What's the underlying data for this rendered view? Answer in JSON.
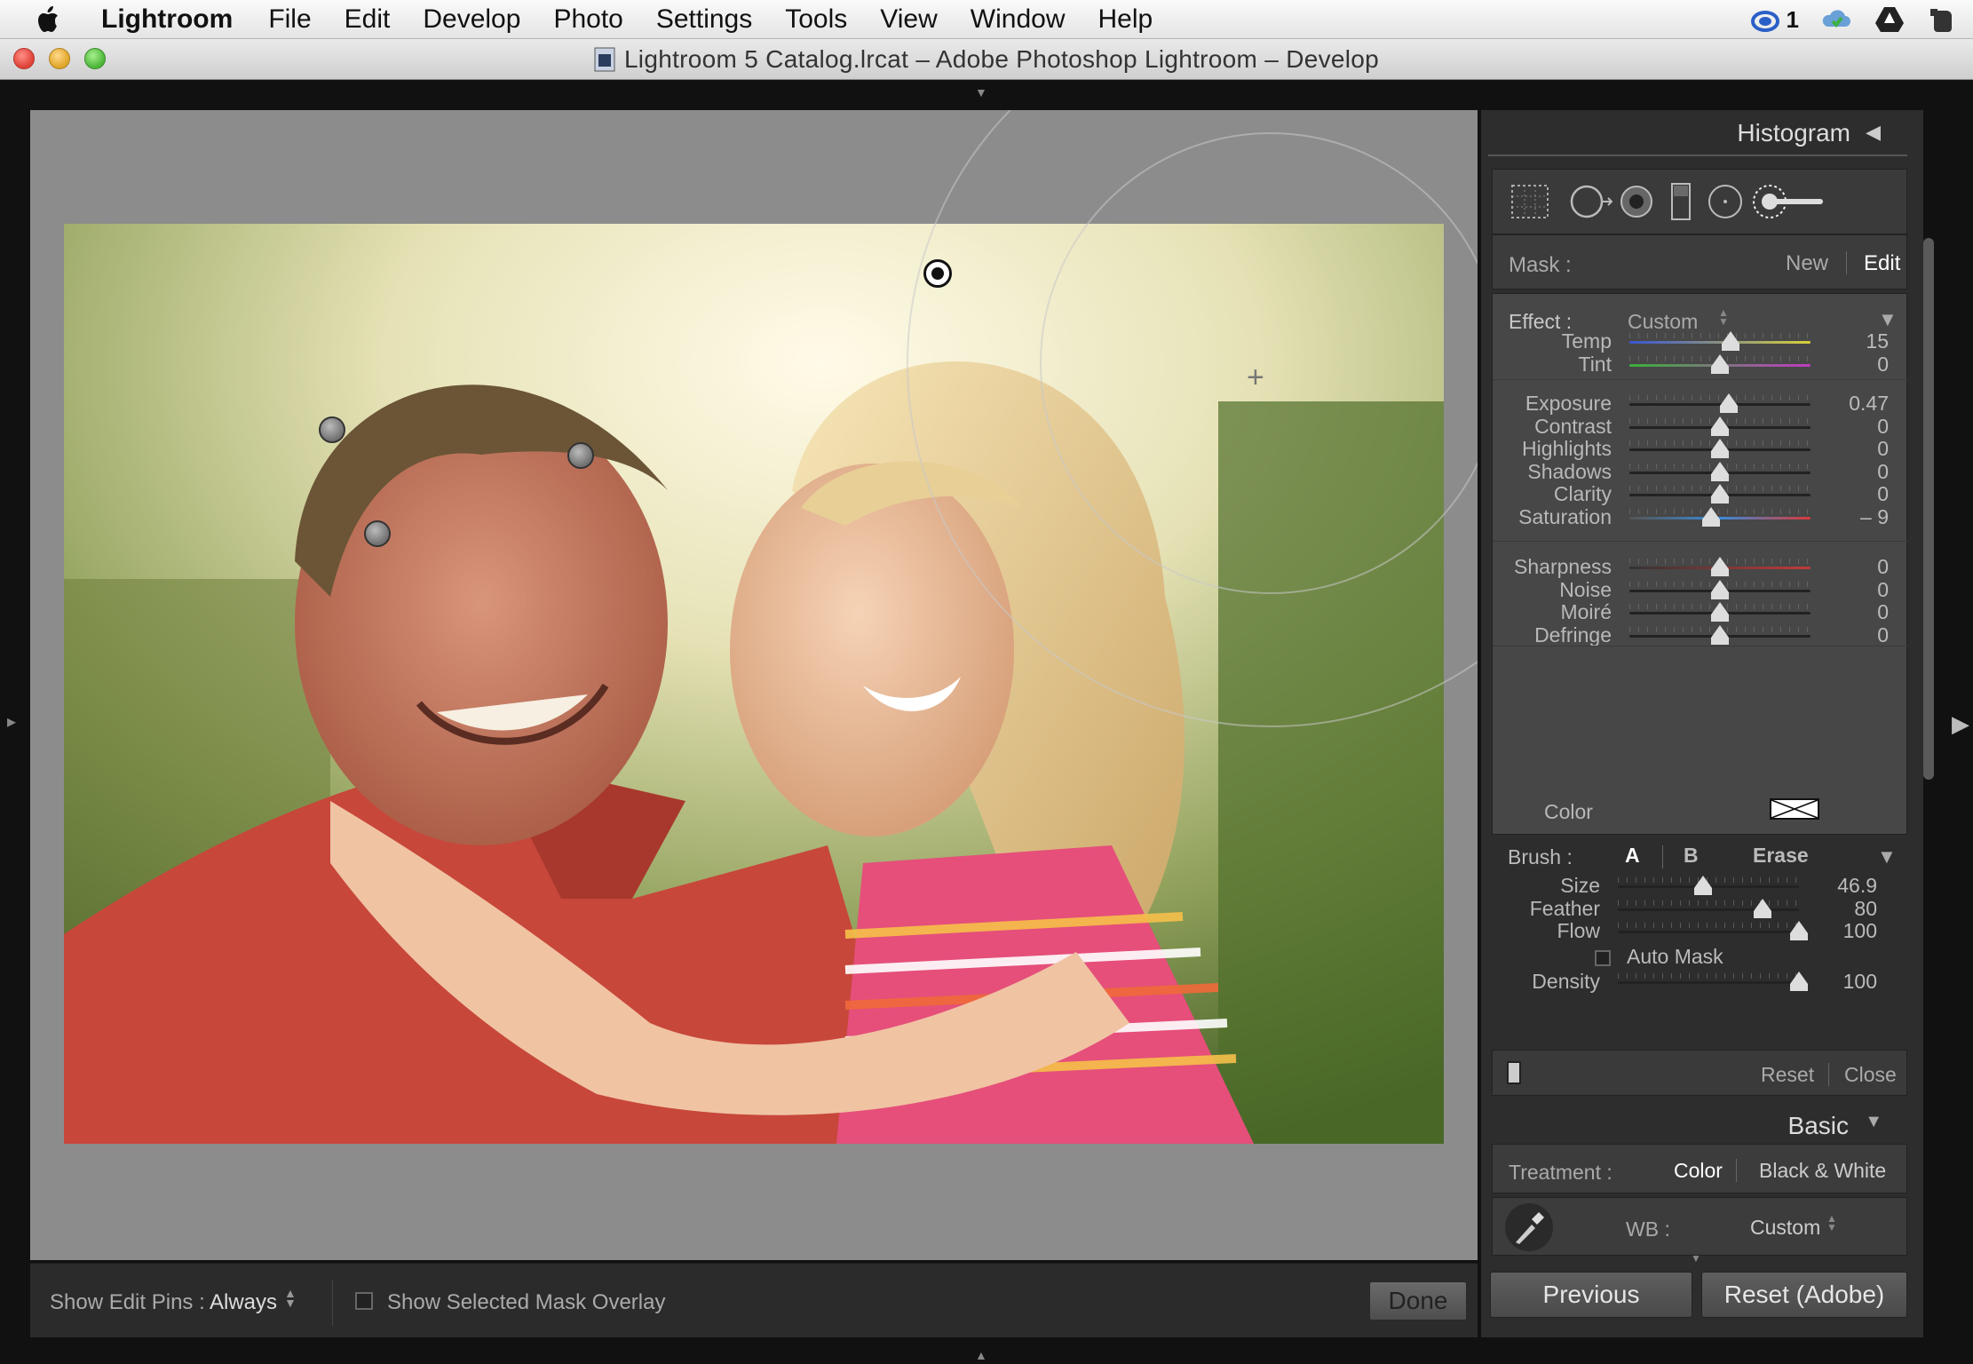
{
  "menubar": {
    "app": "Lightroom",
    "items": [
      "File",
      "Edit",
      "Develop",
      "Photo",
      "Settings",
      "Tools",
      "View",
      "Window",
      "Help"
    ],
    "tray_count": "1"
  },
  "window": {
    "title": "Lightroom 5 Catalog.lrcat – Adobe Photoshop Lightroom – Develop"
  },
  "toolbar": {
    "show_edit_pins_label": "Show Edit Pins :",
    "show_edit_pins_value": "Always",
    "show_mask_overlay_label": "Show Selected Mask Overlay",
    "done_label": "Done"
  },
  "panel": {
    "histogram_title": "Histogram",
    "mask": {
      "label": "Mask :",
      "new": "New",
      "edit": "Edit"
    },
    "effect": {
      "label": "Effect :",
      "value": "Custom",
      "groups": [
        [
          {
            "label": "Temp",
            "value": "15",
            "pos": 0.56,
            "track": "temp"
          },
          {
            "label": "Tint",
            "value": "0",
            "pos": 0.5,
            "track": "tint"
          }
        ],
        [
          {
            "label": "Exposure",
            "value": "0.47",
            "pos": 0.55,
            "track": "plain"
          },
          {
            "label": "Contrast",
            "value": "0",
            "pos": 0.5,
            "track": "plain"
          },
          {
            "label": "Highlights",
            "value": "0",
            "pos": 0.5,
            "track": "plain"
          },
          {
            "label": "Shadows",
            "value": "0",
            "pos": 0.5,
            "track": "plain"
          },
          {
            "label": "Clarity",
            "value": "0",
            "pos": 0.5,
            "track": "plain"
          },
          {
            "label": "Saturation",
            "value": "– 9",
            "pos": 0.45,
            "track": "sat"
          }
        ],
        [
          {
            "label": "Sharpness",
            "value": "0",
            "pos": 0.5,
            "track": "sharp"
          },
          {
            "label": "Noise",
            "value": "0",
            "pos": 0.5,
            "track": "plain"
          },
          {
            "label": "Moiré",
            "value": "0",
            "pos": 0.5,
            "track": "plain"
          },
          {
            "label": "Defringe",
            "value": "0",
            "pos": 0.5,
            "track": "plain"
          }
        ]
      ],
      "color_label": "Color"
    },
    "brush": {
      "label": "Brush :",
      "a": "A",
      "b": "B",
      "erase": "Erase",
      "sliders": [
        {
          "label": "Size",
          "value": "46.9",
          "pos": 0.47
        },
        {
          "label": "Feather",
          "value": "80",
          "pos": 0.8
        },
        {
          "label": "Flow",
          "value": "100",
          "pos": 1.0
        }
      ],
      "auto_mask": "Auto Mask",
      "density": {
        "label": "Density",
        "value": "100",
        "pos": 1.0
      }
    },
    "reset": "Reset",
    "close": "Close",
    "basic_title": "Basic",
    "treatment": {
      "label": "Treatment :",
      "color": "Color",
      "bw": "Black & White"
    },
    "wb": {
      "label": "WB :",
      "value": "Custom"
    },
    "previous": "Previous",
    "reset_adobe": "Reset (Adobe)"
  }
}
